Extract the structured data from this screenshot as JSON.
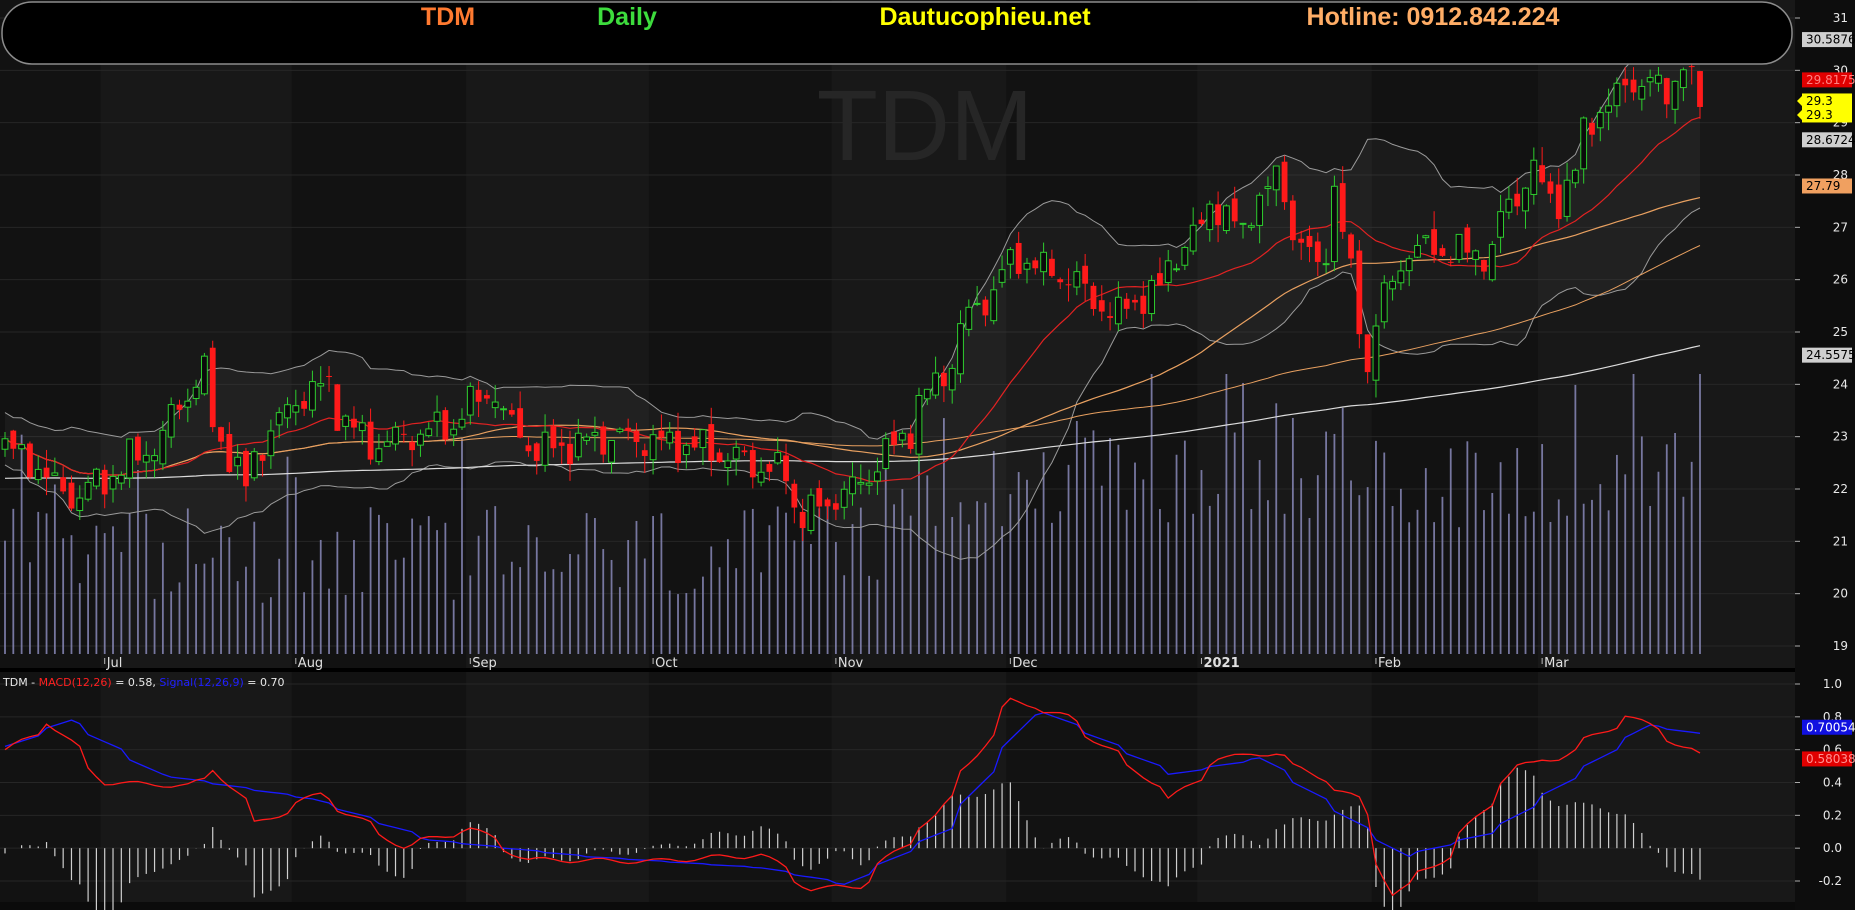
{
  "header": {
    "ticker": "TDM",
    "timeframe": "Daily",
    "site": "Dautucophieu.net",
    "hotline": "Hotline: 0912.842.224",
    "watermark": "TDM"
  },
  "colors": {
    "ticker": "#ff7a30",
    "timeframe": "#3ddc3d",
    "site": "#ffff00",
    "hotline": "#ffad66",
    "up": "#2ecc2e",
    "down": "#ff1a1a",
    "ma20": "#e22222",
    "ma50": "#e8a060",
    "ma100": "#e8a060",
    "ma200": "#dcdcdc",
    "bollinger": "#9a9a9a",
    "volume": "#8888b8",
    "macd": "#ff1a1a",
    "signal": "#1a1aff",
    "hist": "#cfcfcf"
  },
  "price_axis": {
    "ticks": [
      "19",
      "20",
      "21",
      "22",
      "23",
      "24",
      "25",
      "26",
      "27",
      "28",
      "29",
      "30",
      "31"
    ],
    "tags": [
      {
        "label": "30.5876",
        "bg": "#cfcfcf",
        "fg": "#000000"
      },
      {
        "label": "29.8175",
        "bg": "#e00000",
        "fg": "#ff8080"
      },
      {
        "label": "29.3",
        "bg": "#ffff00",
        "fg": "#000000"
      },
      {
        "label": "29.3",
        "bg": "#ffff00",
        "fg": "#000000"
      },
      {
        "label": "28.6724",
        "bg": "#cfcfcf",
        "fg": "#000000"
      },
      {
        "label": "27.79",
        "bg": "#f0a060",
        "fg": "#000000"
      },
      {
        "label": "24.5575",
        "bg": "#cfcfcf",
        "fg": "#000000"
      }
    ]
  },
  "months": [
    "Jul",
    "Aug",
    "Sep",
    "Oct",
    "Nov",
    "Dec",
    "2021",
    "Feb",
    "Mar"
  ],
  "macd_panel": {
    "label_ticker": "TDM - ",
    "label_macd": "MACD(12,26)",
    "label_macd_val": " = 0.58, ",
    "label_signal": "Signal(12,26,9)",
    "label_signal_val": " = 0.70",
    "ticks": [
      "1.0",
      "0.8",
      "0.6",
      "0.4",
      "0.2",
      "0.0",
      "-0.2"
    ],
    "tags": [
      {
        "label": "0.70054",
        "bg": "#1010e0",
        "fg": "#ffffff"
      },
      {
        "label": "0.58038",
        "bg": "#e00000",
        "fg": "#ff9090"
      }
    ]
  },
  "chart_data": [
    {
      "type": "candlestick",
      "title": "TDM Daily",
      "ylim": [
        18.7,
        31.4
      ],
      "x_months": [
        "Jul",
        "Aug",
        "Sep",
        "Oct",
        "Nov",
        "Dec",
        "2021",
        "Feb",
        "Mar"
      ],
      "close_anchors": [
        {
          "date": "2020-06-15",
          "close": 22.8
        },
        {
          "date": "2020-06-26",
          "close": 21.8
        },
        {
          "date": "2020-07-10",
          "close": 22.9
        },
        {
          "date": "2020-07-17",
          "close": 24.2
        },
        {
          "date": "2020-07-24",
          "close": 22.0
        },
        {
          "date": "2020-07-31",
          "close": 23.5
        },
        {
          "date": "2020-08-07",
          "close": 24.0
        },
        {
          "date": "2020-08-14",
          "close": 22.8
        },
        {
          "date": "2020-08-28",
          "close": 23.2
        },
        {
          "date": "2020-09-04",
          "close": 23.9
        },
        {
          "date": "2020-09-11",
          "close": 22.7
        },
        {
          "date": "2020-09-25",
          "close": 23.0
        },
        {
          "date": "2020-10-09",
          "close": 22.8
        },
        {
          "date": "2020-10-23",
          "close": 22.3
        },
        {
          "date": "2020-10-27",
          "close": 21.5
        },
        {
          "date": "2020-11-04",
          "close": 22.0
        },
        {
          "date": "2020-11-11",
          "close": 22.8
        },
        {
          "date": "2020-11-18",
          "close": 24.0
        },
        {
          "date": "2020-11-25",
          "close": 25.5
        },
        {
          "date": "2020-12-02",
          "close": 26.4
        },
        {
          "date": "2020-12-11",
          "close": 26.0
        },
        {
          "date": "2020-12-18",
          "close": 25.3
        },
        {
          "date": "2020-12-25",
          "close": 25.8
        },
        {
          "date": "2021-01-04",
          "close": 27.5
        },
        {
          "date": "2021-01-08",
          "close": 26.9
        },
        {
          "date": "2021-01-14",
          "close": 27.9
        },
        {
          "date": "2021-01-21",
          "close": 26.2
        },
        {
          "date": "2021-01-25",
          "close": 27.8
        },
        {
          "date": "2021-01-29",
          "close": 24.3
        },
        {
          "date": "2021-02-05",
          "close": 26.6
        },
        {
          "date": "2021-02-19",
          "close": 26.5
        },
        {
          "date": "2021-02-26",
          "close": 28.1
        },
        {
          "date": "2021-03-03",
          "close": 27.5
        },
        {
          "date": "2021-03-09",
          "close": 29.1
        },
        {
          "date": "2021-03-15",
          "close": 29.8
        },
        {
          "date": "2021-03-22",
          "close": 29.6
        },
        {
          "date": "2021-03-24",
          "close": 30.1
        },
        {
          "date": "2021-03-26",
          "close": 29.3
        }
      ],
      "bollinger_upper_last": 30.5876,
      "bollinger_lower_last": 28.6724,
      "ma20_last": 29.8175,
      "ma50_last": 27.79,
      "ma200_last": 24.5575,
      "last_close": 29.3
    },
    {
      "type": "line",
      "title": "MACD(12,26)",
      "ylim": [
        -0.3,
        1.05
      ],
      "series": [
        {
          "name": "MACD(12,26)",
          "last": 0.58
        },
        {
          "name": "Signal(12,26,9)",
          "last": 0.7
        }
      ],
      "macd_anchors": [
        {
          "date": "2020-06-15",
          "value": 0.6
        },
        {
          "date": "2020-06-22",
          "value": 0.77
        },
        {
          "date": "2020-07-01",
          "value": 0.4
        },
        {
          "date": "2020-07-15",
          "value": 0.38
        },
        {
          "date": "2020-07-20",
          "value": 0.48
        },
        {
          "date": "2020-07-27",
          "value": 0.15
        },
        {
          "date": "2020-08-06",
          "value": 0.33
        },
        {
          "date": "2020-08-20",
          "value": 0.01
        },
        {
          "date": "2020-09-01",
          "value": 0.12
        },
        {
          "date": "2020-09-10",
          "value": -0.07
        },
        {
          "date": "2020-10-01",
          "value": -0.08
        },
        {
          "date": "2020-10-20",
          "value": -0.04
        },
        {
          "date": "2020-10-28",
          "value": -0.25
        },
        {
          "date": "2020-11-05",
          "value": -0.23
        },
        {
          "date": "2020-11-18",
          "value": 0.2
        },
        {
          "date": "2020-12-01",
          "value": 0.9
        },
        {
          "date": "2020-12-10",
          "value": 0.8
        },
        {
          "date": "2020-12-28",
          "value": 0.3
        },
        {
          "date": "2021-01-05",
          "value": 0.55
        },
        {
          "date": "2021-01-14",
          "value": 0.58
        },
        {
          "date": "2021-01-28",
          "value": 0.3
        },
        {
          "date": "2021-02-03",
          "value": -0.28
        },
        {
          "date": "2021-02-12",
          "value": -0.05
        },
        {
          "date": "2021-02-24",
          "value": 0.5
        },
        {
          "date": "2021-03-03",
          "value": 0.55
        },
        {
          "date": "2021-03-15",
          "value": 0.81
        },
        {
          "date": "2021-03-26",
          "value": 0.58
        }
      ],
      "signal_anchors": [
        {
          "date": "2020-06-15",
          "value": 0.62
        },
        {
          "date": "2020-06-25",
          "value": 0.78
        },
        {
          "date": "2020-07-10",
          "value": 0.45
        },
        {
          "date": "2020-08-05",
          "value": 0.3
        },
        {
          "date": "2020-08-25",
          "value": 0.05
        },
        {
          "date": "2020-09-20",
          "value": -0.05
        },
        {
          "date": "2020-10-20",
          "value": -0.12
        },
        {
          "date": "2020-11-03",
          "value": -0.22
        },
        {
          "date": "2020-11-20",
          "value": 0.12
        },
        {
          "date": "2020-12-05",
          "value": 0.86
        },
        {
          "date": "2020-12-28",
          "value": 0.45
        },
        {
          "date": "2021-01-12",
          "value": 0.55
        },
        {
          "date": "2021-02-05",
          "value": -0.05
        },
        {
          "date": "2021-02-20",
          "value": 0.1
        },
        {
          "date": "2021-03-18",
          "value": 0.75
        },
        {
          "date": "2021-03-26",
          "value": 0.7
        }
      ]
    }
  ]
}
